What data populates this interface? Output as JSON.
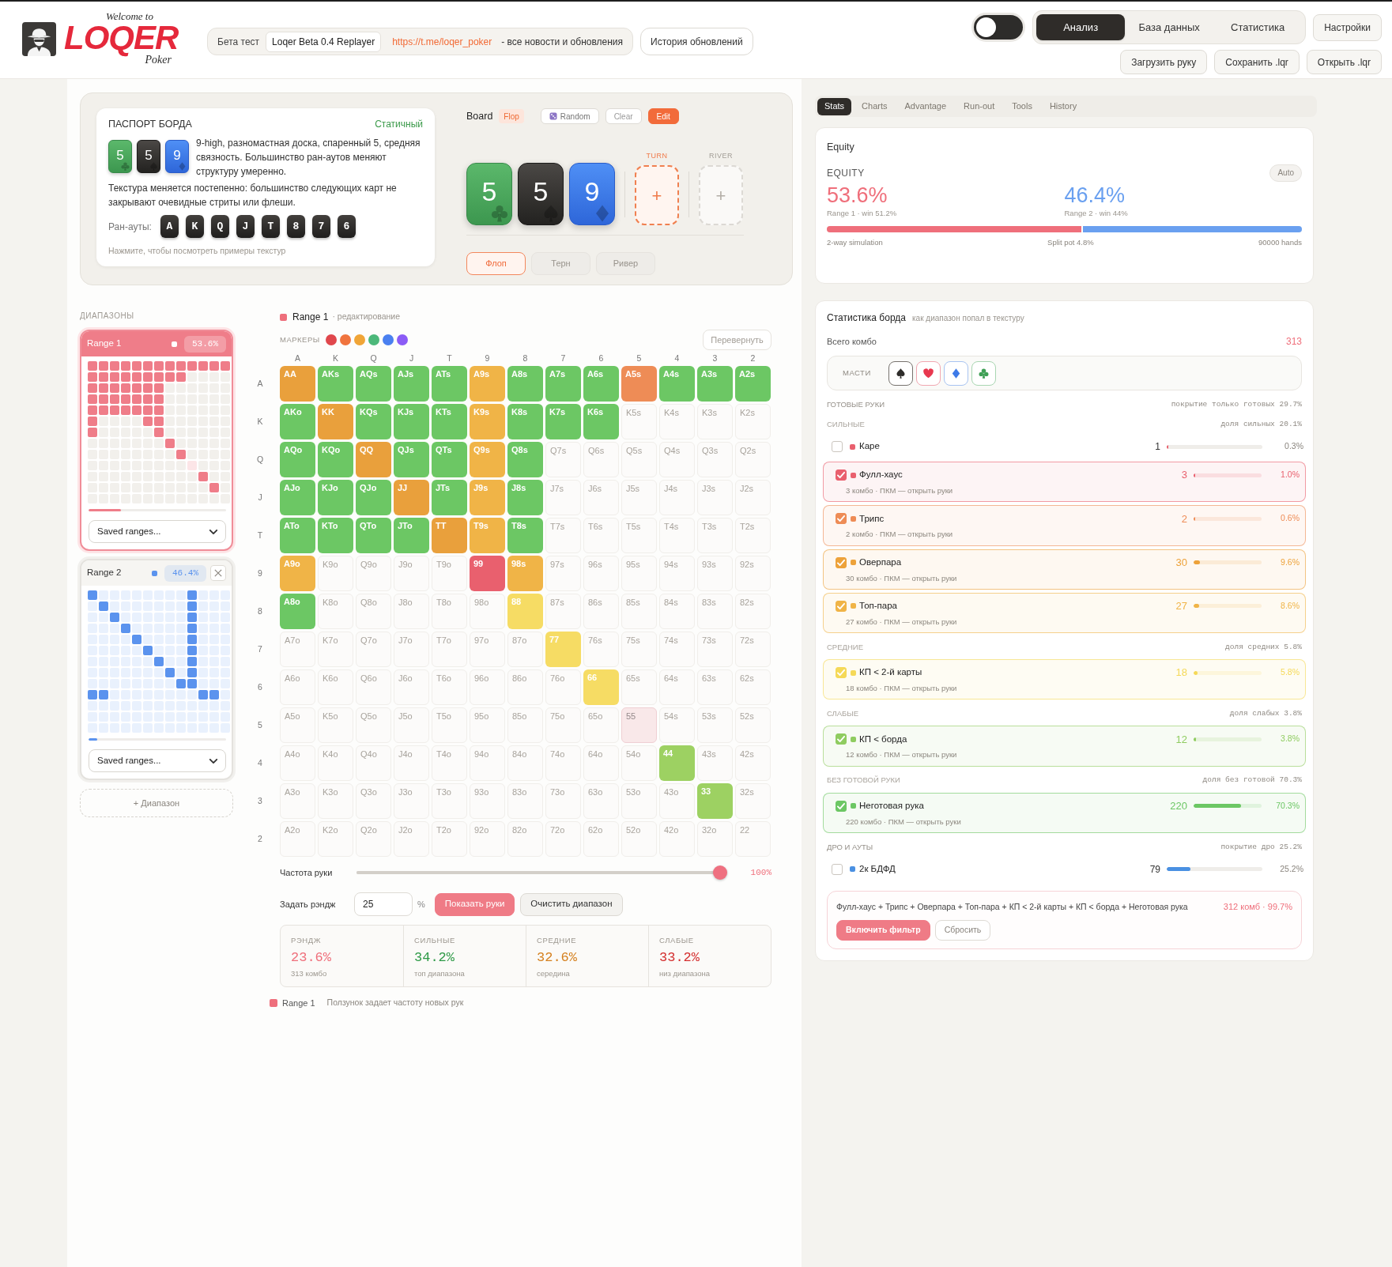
{
  "header": {
    "logo": {
      "top": "Welcome to",
      "main": "LOQER",
      "bottom": "Poker"
    },
    "beta": {
      "label": "Бета тест",
      "version": "Loqer Beta 0.4 Replayer",
      "link": "https://t.me/loqer_poker",
      "note": "- все новости и обновления"
    },
    "history_button": "История обновлений",
    "theme_toggle": {
      "on": false
    },
    "tabs": [
      {
        "label": "Анализ",
        "selected": true
      },
      {
        "label": "База данных",
        "selected": false
      },
      {
        "label": "Статистика",
        "selected": false
      }
    ],
    "settings_button": "Настройки",
    "actions": [
      "Загрузить руку",
      "Сохранить .lqr",
      "Открыть .lqr"
    ]
  },
  "passport": {
    "title": "ПАСПОРТ БОРДА",
    "texture": "Статичный",
    "cards": [
      {
        "rank": "5",
        "kind": "clubs"
      },
      {
        "rank": "5",
        "kind": "spades"
      },
      {
        "rank": "9",
        "kind": "diamonds"
      }
    ],
    "summary": "9-high, разномастная доска, спаренный 5, средняя связность. Большинство ран-аутов меняют структуру умеренно.",
    "dynamics": "Текстура меняется постепенно: большинство следующих карт не закрывают очевидные стриты или флеши.",
    "runouts_label": "Ран-ауты:",
    "runouts": [
      "A",
      "K",
      "Q",
      "J",
      "T",
      "8",
      "7",
      "6"
    ],
    "hint": "Нажмите, чтобы посмотреть примеры текстур"
  },
  "board": {
    "title": "Board",
    "street_tag": "Flop",
    "buttons": [
      {
        "label": "Random",
        "kind": "random"
      },
      {
        "label": "Clear",
        "kind": "plain"
      },
      {
        "label": "Edit",
        "kind": "primary"
      }
    ],
    "cards": [
      {
        "rank": "5",
        "kind": "clubs"
      },
      {
        "rank": "5",
        "kind": "spades"
      },
      {
        "rank": "9",
        "kind": "diamonds"
      }
    ],
    "slots": [
      {
        "label": "TURN",
        "symbol": "+",
        "active": true
      },
      {
        "label": "RIVER",
        "symbol": "+",
        "active": false
      }
    ],
    "streets": [
      {
        "label": "Флоп",
        "selected": true
      },
      {
        "label": "Терн",
        "selected": false
      },
      {
        "label": "Ривер",
        "selected": false
      }
    ]
  },
  "ranges": {
    "title": "ДИАПАЗОНЫ",
    "items": [
      {
        "name": "Range 1",
        "equity": "53.6%",
        "selected": true,
        "closable": false,
        "color": "#ef7d89",
        "level": 0.236,
        "select": "Saved ranges..."
      },
      {
        "name": "Range 2",
        "equity": "46.4%",
        "selected": false,
        "closable": true,
        "color": "#5b93ee",
        "level": 0.065,
        "select": "Saved ranges...",
        "grid": [
          [
            true,
            false,
            false,
            false,
            false,
            false,
            false,
            false,
            false,
            true,
            false,
            false,
            false
          ],
          [
            false,
            true,
            false,
            false,
            false,
            false,
            false,
            false,
            false,
            true,
            false,
            false,
            false
          ],
          [
            false,
            false,
            true,
            false,
            false,
            false,
            false,
            false,
            false,
            true,
            false,
            false,
            false
          ],
          [
            false,
            false,
            false,
            true,
            false,
            false,
            false,
            false,
            false,
            true,
            false,
            false,
            false
          ],
          [
            false,
            false,
            false,
            false,
            true,
            false,
            false,
            false,
            false,
            true,
            false,
            false,
            false
          ],
          [
            false,
            false,
            false,
            false,
            false,
            true,
            false,
            false,
            false,
            true,
            false,
            false,
            false
          ],
          [
            false,
            false,
            false,
            false,
            false,
            false,
            true,
            false,
            false,
            true,
            false,
            false,
            false
          ],
          [
            false,
            false,
            false,
            false,
            false,
            false,
            false,
            true,
            false,
            true,
            false,
            false,
            false
          ],
          [
            false,
            false,
            false,
            false,
            false,
            false,
            false,
            false,
            true,
            true,
            false,
            false,
            false
          ],
          [
            true,
            true,
            false,
            false,
            false,
            false,
            false,
            false,
            false,
            false,
            true,
            true,
            false
          ],
          [
            false,
            false,
            false,
            false,
            false,
            false,
            false,
            false,
            false,
            false,
            false,
            false,
            false
          ],
          [
            false,
            false,
            false,
            false,
            false,
            false,
            false,
            false,
            false,
            false,
            false,
            false,
            false
          ],
          [
            false,
            false,
            false,
            false,
            false,
            false,
            false,
            false,
            false,
            false,
            false,
            false,
            false
          ]
        ]
      }
    ],
    "add_button": "+ Диапазон"
  },
  "matrix": {
    "range": "Range 1",
    "mode": "· редактирование",
    "color": "#ee6f7c",
    "markers_label": "МАРКЕРЫ",
    "markers": [
      {
        "color": "#e0474c"
      },
      {
        "color": "#f0743e"
      },
      {
        "color": "#f0a537"
      },
      {
        "color": "#4cb87a"
      },
      {
        "color": "#4a80f0"
      },
      {
        "color": "#8b5cf6"
      }
    ],
    "flip_button": "Перевернуть",
    "columns": [
      "A",
      "K",
      "Q",
      "J",
      "T",
      "9",
      "8",
      "7",
      "6",
      "5",
      "4",
      "3",
      "2"
    ],
    "rows": [
      {
        "label": "A",
        "cells": [
          {
            "label": "AA",
            "kind": "filled",
            "color": "#e9a03c"
          },
          {
            "label": "AKs",
            "kind": "filled",
            "color": "#6cc764"
          },
          {
            "label": "AQs",
            "kind": "filled",
            "color": "#6cc764"
          },
          {
            "label": "AJs",
            "kind": "filled",
            "color": "#6cc764"
          },
          {
            "label": "ATs",
            "kind": "filled",
            "color": "#6cc764"
          },
          {
            "label": "A9s",
            "kind": "filled",
            "color": "#f0b447"
          },
          {
            "label": "A8s",
            "kind": "filled",
            "color": "#6cc764"
          },
          {
            "label": "A7s",
            "kind": "filled",
            "color": "#6cc764"
          },
          {
            "label": "A6s",
            "kind": "filled",
            "color": "#6cc764"
          },
          {
            "label": "A5s",
            "kind": "filled",
            "color": "#ee8c56"
          },
          {
            "label": "A4s",
            "kind": "filled",
            "color": "#6cc764"
          },
          {
            "label": "A3s",
            "kind": "filled",
            "color": "#6cc764"
          },
          {
            "label": "A2s",
            "kind": "filled",
            "color": "#6cc764"
          }
        ]
      },
      {
        "label": "K",
        "cells": [
          {
            "label": "AKo",
            "kind": "filled",
            "color": "#6cc764"
          },
          {
            "label": "KK",
            "kind": "filled",
            "color": "#e9a03c"
          },
          {
            "label": "KQs",
            "kind": "filled",
            "color": "#6cc764"
          },
          {
            "label": "KJs",
            "kind": "filled",
            "color": "#6cc764"
          },
          {
            "label": "KTs",
            "kind": "filled",
            "color": "#6cc764"
          },
          {
            "label": "K9s",
            "kind": "filled",
            "color": "#f0b447"
          },
          {
            "label": "K8s",
            "kind": "filled",
            "color": "#6cc764"
          },
          {
            "label": "K7s",
            "kind": "filled",
            "color": "#6cc764"
          },
          {
            "label": "K6s",
            "kind": "filled",
            "color": "#6cc764"
          },
          {
            "label": "K5s",
            "kind": "empty"
          },
          {
            "label": "K4s",
            "kind": "empty"
          },
          {
            "label": "K3s",
            "kind": "empty"
          },
          {
            "label": "K2s",
            "kind": "empty"
          }
        ]
      },
      {
        "label": "Q",
        "cells": [
          {
            "label": "AQo",
            "kind": "filled",
            "color": "#6cc764"
          },
          {
            "label": "KQo",
            "kind": "filled",
            "color": "#6cc764"
          },
          {
            "label": "QQ",
            "kind": "filled",
            "color": "#e9a03c"
          },
          {
            "label": "QJs",
            "kind": "filled",
            "color": "#6cc764"
          },
          {
            "label": "QTs",
            "kind": "filled",
            "color": "#6cc764"
          },
          {
            "label": "Q9s",
            "kind": "filled",
            "color": "#f0b447"
          },
          {
            "label": "Q8s",
            "kind": "filled",
            "color": "#6cc764"
          },
          {
            "label": "Q7s",
            "kind": "empty"
          },
          {
            "label": "Q6s",
            "kind": "empty"
          },
          {
            "label": "Q5s",
            "kind": "empty"
          },
          {
            "label": "Q4s",
            "kind": "empty"
          },
          {
            "label": "Q3s",
            "kind": "empty"
          },
          {
            "label": "Q2s",
            "kind": "empty"
          }
        ]
      },
      {
        "label": "J",
        "cells": [
          {
            "label": "AJo",
            "kind": "filled",
            "color": "#6cc764"
          },
          {
            "label": "KJo",
            "kind": "filled",
            "color": "#6cc764"
          },
          {
            "label": "QJo",
            "kind": "filled",
            "color": "#6cc764"
          },
          {
            "label": "JJ",
            "kind": "filled",
            "color": "#e9a03c"
          },
          {
            "label": "JTs",
            "kind": "filled",
            "color": "#6cc764"
          },
          {
            "label": "J9s",
            "kind": "filled",
            "color": "#f0b447"
          },
          {
            "label": "J8s",
            "kind": "filled",
            "color": "#6cc764"
          },
          {
            "label": "J7s",
            "kind": "empty"
          },
          {
            "label": "J6s",
            "kind": "empty"
          },
          {
            "label": "J5s",
            "kind": "empty"
          },
          {
            "label": "J4s",
            "kind": "empty"
          },
          {
            "label": "J3s",
            "kind": "empty"
          },
          {
            "label": "J2s",
            "kind": "empty"
          }
        ]
      },
      {
        "label": "T",
        "cells": [
          {
            "label": "ATo",
            "kind": "filled",
            "color": "#6cc764"
          },
          {
            "label": "KTo",
            "kind": "filled",
            "color": "#6cc764"
          },
          {
            "label": "QTo",
            "kind": "filled",
            "color": "#6cc764"
          },
          {
            "label": "JTo",
            "kind": "filled",
            "color": "#6cc764"
          },
          {
            "label": "TT",
            "kind": "filled",
            "color": "#e9a03c"
          },
          {
            "label": "T9s",
            "kind": "filled",
            "color": "#f0b447"
          },
          {
            "label": "T8s",
            "kind": "filled",
            "color": "#6cc764"
          },
          {
            "label": "T7s",
            "kind": "empty"
          },
          {
            "label": "T6s",
            "kind": "empty"
          },
          {
            "label": "T5s",
            "kind": "empty"
          },
          {
            "label": "T4s",
            "kind": "empty"
          },
          {
            "label": "T3s",
            "kind": "empty"
          },
          {
            "label": "T2s",
            "kind": "empty"
          }
        ]
      },
      {
        "label": "9",
        "cells": [
          {
            "label": "A9o",
            "kind": "filled",
            "color": "#f0b447"
          },
          {
            "label": "K9o",
            "kind": "empty"
          },
          {
            "label": "Q9o",
            "kind": "empty"
          },
          {
            "label": "J9o",
            "kind": "empty"
          },
          {
            "label": "T9o",
            "kind": "empty"
          },
          {
            "label": "99",
            "kind": "filled",
            "color": "#e9606e"
          },
          {
            "label": "98s",
            "kind": "filled",
            "color": "#f0b447"
          },
          {
            "label": "97s",
            "kind": "empty"
          },
          {
            "label": "96s",
            "kind": "empty"
          },
          {
            "label": "95s",
            "kind": "empty"
          },
          {
            "label": "94s",
            "kind": "empty"
          },
          {
            "label": "93s",
            "kind": "empty"
          },
          {
            "label": "92s",
            "kind": "empty"
          }
        ]
      },
      {
        "label": "8",
        "cells": [
          {
            "label": "A8o",
            "kind": "filled",
            "color": "#6cc764"
          },
          {
            "label": "K8o",
            "kind": "empty"
          },
          {
            "label": "Q8o",
            "kind": "empty"
          },
          {
            "label": "J8o",
            "kind": "empty"
          },
          {
            "label": "T8o",
            "kind": "empty"
          },
          {
            "label": "98o",
            "kind": "empty"
          },
          {
            "label": "88",
            "kind": "filled",
            "color": "#f6dc64"
          },
          {
            "label": "87s",
            "kind": "empty"
          },
          {
            "label": "86s",
            "kind": "empty"
          },
          {
            "label": "85s",
            "kind": "empty"
          },
          {
            "label": "84s",
            "kind": "empty"
          },
          {
            "label": "83s",
            "kind": "empty"
          },
          {
            "label": "82s",
            "kind": "empty"
          }
        ]
      },
      {
        "label": "7",
        "cells": [
          {
            "label": "A7o",
            "kind": "empty"
          },
          {
            "label": "K7o",
            "kind": "empty"
          },
          {
            "label": "Q7o",
            "kind": "empty"
          },
          {
            "label": "J7o",
            "kind": "empty"
          },
          {
            "label": "T7o",
            "kind": "empty"
          },
          {
            "label": "97o",
            "kind": "empty"
          },
          {
            "label": "87o",
            "kind": "empty"
          },
          {
            "label": "77",
            "kind": "filled",
            "color": "#f6dc64"
          },
          {
            "label": "76s",
            "kind": "empty"
          },
          {
            "label": "75s",
            "kind": "empty"
          },
          {
            "label": "74s",
            "kind": "empty"
          },
          {
            "label": "73s",
            "kind": "empty"
          },
          {
            "label": "72s",
            "kind": "empty"
          }
        ]
      },
      {
        "label": "6",
        "cells": [
          {
            "label": "A6o",
            "kind": "empty"
          },
          {
            "label": "K6o",
            "kind": "empty"
          },
          {
            "label": "Q6o",
            "kind": "empty"
          },
          {
            "label": "J6o",
            "kind": "empty"
          },
          {
            "label": "T6o",
            "kind": "empty"
          },
          {
            "label": "96o",
            "kind": "empty"
          },
          {
            "label": "86o",
            "kind": "empty"
          },
          {
            "label": "76o",
            "kind": "empty"
          },
          {
            "label": "66",
            "kind": "filled",
            "color": "#f6dc64"
          },
          {
            "label": "65s",
            "kind": "empty"
          },
          {
            "label": "64s",
            "kind": "empty"
          },
          {
            "label": "63s",
            "kind": "empty"
          },
          {
            "label": "62s",
            "kind": "empty"
          }
        ]
      },
      {
        "label": "5",
        "cells": [
          {
            "label": "A5o",
            "kind": "empty"
          },
          {
            "label": "K5o",
            "kind": "empty"
          },
          {
            "label": "Q5o",
            "kind": "empty"
          },
          {
            "label": "J5o",
            "kind": "empty"
          },
          {
            "label": "T5o",
            "kind": "empty"
          },
          {
            "label": "95o",
            "kind": "empty"
          },
          {
            "label": "85o",
            "kind": "empty"
          },
          {
            "label": "75o",
            "kind": "empty"
          },
          {
            "label": "65o",
            "kind": "empty"
          },
          {
            "label": "55",
            "kind": "faded",
            "color": "#f9e8e9"
          },
          {
            "label": "54s",
            "kind": "empty"
          },
          {
            "label": "53s",
            "kind": "empty"
          },
          {
            "label": "52s",
            "kind": "empty"
          }
        ]
      },
      {
        "label": "4",
        "cells": [
          {
            "label": "A4o",
            "kind": "empty"
          },
          {
            "label": "K4o",
            "kind": "empty"
          },
          {
            "label": "Q4o",
            "kind": "empty"
          },
          {
            "label": "J4o",
            "kind": "empty"
          },
          {
            "label": "T4o",
            "kind": "empty"
          },
          {
            "label": "94o",
            "kind": "empty"
          },
          {
            "label": "84o",
            "kind": "empty"
          },
          {
            "label": "74o",
            "kind": "empty"
          },
          {
            "label": "64o",
            "kind": "empty"
          },
          {
            "label": "54o",
            "kind": "empty"
          },
          {
            "label": "44",
            "kind": "filled",
            "color": "#9dd162"
          },
          {
            "label": "43s",
            "kind": "empty"
          },
          {
            "label": "42s",
            "kind": "empty"
          }
        ]
      },
      {
        "label": "3",
        "cells": [
          {
            "label": "A3o",
            "kind": "empty"
          },
          {
            "label": "K3o",
            "kind": "empty"
          },
          {
            "label": "Q3o",
            "kind": "empty"
          },
          {
            "label": "J3o",
            "kind": "empty"
          },
          {
            "label": "T3o",
            "kind": "empty"
          },
          {
            "label": "93o",
            "kind": "empty"
          },
          {
            "label": "83o",
            "kind": "empty"
          },
          {
            "label": "73o",
            "kind": "empty"
          },
          {
            "label": "63o",
            "kind": "empty"
          },
          {
            "label": "53o",
            "kind": "empty"
          },
          {
            "label": "43o",
            "kind": "empty"
          },
          {
            "label": "33",
            "kind": "filled",
            "color": "#9dd162"
          },
          {
            "label": "32s",
            "kind": "empty"
          }
        ]
      },
      {
        "label": "2",
        "cells": [
          {
            "label": "A2o",
            "kind": "empty"
          },
          {
            "label": "K2o",
            "kind": "empty"
          },
          {
            "label": "Q2o",
            "kind": "empty"
          },
          {
            "label": "J2o",
            "kind": "empty"
          },
          {
            "label": "T2o",
            "kind": "empty"
          },
          {
            "label": "92o",
            "kind": "empty"
          },
          {
            "label": "82o",
            "kind": "empty"
          },
          {
            "label": "72o",
            "kind": "empty"
          },
          {
            "label": "62o",
            "kind": "empty"
          },
          {
            "label": "52o",
            "kind": "empty"
          },
          {
            "label": "42o",
            "kind": "empty"
          },
          {
            "label": "32o",
            "kind": "empty"
          },
          {
            "label": "22",
            "kind": "empty"
          }
        ]
      }
    ]
  },
  "frequency": {
    "label": "Частота руки",
    "level": 1,
    "reading": "100%"
  },
  "set_range": {
    "label": "Задать рэндж",
    "value": "25",
    "unit": "%",
    "buttons": [
      {
        "label": "Показать руки",
        "kind": "primary"
      },
      {
        "label": "Очистить диапазон",
        "kind": "secondary"
      }
    ]
  },
  "summary": [
    {
      "label": "РЭНДЖ",
      "value": "23.6%",
      "note": "313 комбо",
      "color": "#ef6f7b"
    },
    {
      "label": "СИЛЬНЫЕ",
      "value": "34.2%",
      "note": "топ диапазона",
      "color": "#2e9a47"
    },
    {
      "label": "СРЕДНИЕ",
      "value": "32.6%",
      "note": "середина",
      "color": "#d5801f"
    },
    {
      "label": "СЛАБЫЕ",
      "value": "33.2%",
      "note": "низ диапазона",
      "color": "#d42e2e"
    }
  ],
  "legend": {
    "range": "Range 1",
    "color": "#ee6f7c",
    "note": "Ползунок задает частоту новых рук"
  },
  "panel_tabs": [
    {
      "label": "Stats",
      "selected": true
    },
    {
      "label": "Charts",
      "selected": false
    },
    {
      "label": "Advantage",
      "selected": false
    },
    {
      "label": "Run-out",
      "selected": false
    },
    {
      "label": "Tools",
      "selected": false
    },
    {
      "label": "History",
      "selected": false
    }
  ],
  "equity": {
    "title": "Equity",
    "label": "EQUITY",
    "mode_button": "Auto",
    "players": [
      {
        "value": "53.6%",
        "caption": "Range 1 · win 51.2%",
        "color": "#ef6f7b",
        "level": 0.536
      },
      {
        "value": "46.4%",
        "caption": "Range 2 · win 44%",
        "color": "#6aa0f0",
        "level": 0.464
      }
    ],
    "footer": [
      "2-way simulation",
      "Split pot 4.8%",
      "90000 hands"
    ]
  },
  "board_stats": {
    "title": "Статистика борда",
    "subtitle": "как диапазон попал в текстуру",
    "total_label": "Всего комбо",
    "total": "313",
    "suits_label": "МАСТИ",
    "suits": [
      {
        "kind": "spades"
      },
      {
        "kind": "hearts"
      },
      {
        "kind": "diamonds"
      },
      {
        "kind": "clubs"
      }
    ],
    "sections": [
      {
        "title": "ГОТОВЫЕ РУКИ",
        "note": "покрытие только готовых 29.7%",
        "kind": "group"
      },
      {
        "title": "СИЛЬНЫЕ",
        "note": "доля сильных 20.1%",
        "kind": "subgroup",
        "rows": [
          {
            "name": "Каре",
            "checked": false,
            "color": "#e9606e",
            "count": "1",
            "level": 0.003,
            "percent": "0.3%"
          },
          {
            "name": "Фулл-хаус",
            "checked": true,
            "color": "#e9606e",
            "count": "3",
            "level": 0.01,
            "percent": "1.0%",
            "detail": "3 комбо · ПКМ — открыть руки"
          },
          {
            "name": "Трипс",
            "checked": true,
            "color": "#ee8c56",
            "count": "2",
            "level": 0.006,
            "percent": "0.6%",
            "detail": "2 комбо · ПКМ — открыть руки"
          },
          {
            "name": "Оверпара",
            "checked": true,
            "color": "#eda23a",
            "count": "30",
            "level": 0.096,
            "percent": "9.6%",
            "detail": "30 комбо · ПКМ — открыть руки"
          },
          {
            "name": "Топ-пара",
            "checked": true,
            "color": "#f0b447",
            "count": "27",
            "level": 0.086,
            "percent": "8.6%",
            "detail": "27 комбо · ПКМ — открыть руки"
          }
        ]
      },
      {
        "title": "СРЕДНИЕ",
        "note": "доля средних 5.8%",
        "kind": "subgroup",
        "rows": [
          {
            "name": "КП < 2-й карты",
            "checked": true,
            "color": "#f5d958",
            "count": "18",
            "level": 0.058,
            "percent": "5.8%",
            "detail": "18 комбо · ПКМ — открыть руки"
          }
        ]
      },
      {
        "title": "СЛАБЫЕ",
        "note": "доля слабых 3.8%",
        "kind": "subgroup",
        "rows": [
          {
            "name": "КП < борда",
            "checked": true,
            "color": "#8fcc60",
            "count": "12",
            "level": 0.038,
            "percent": "3.8%",
            "detail": "12 комбо · ПКМ — открыть руки"
          }
        ]
      },
      {
        "title": "БЕЗ ГОТОВОЙ РУКИ",
        "note": "доля без готовой 70.3%",
        "kind": "subgroup",
        "rows": [
          {
            "name": "Неготовая рука",
            "checked": true,
            "color": "#6cc764",
            "count": "220",
            "level": 0.703,
            "percent": "70.3%",
            "detail": "220 комбо · ПКМ — открыть руки"
          }
        ]
      },
      {
        "title": "ДРО И АУТЫ",
        "note": "покрытие дро 25.2%",
        "kind": "group",
        "rows": [
          {
            "name": "2к БДФД",
            "checked": false,
            "color": "#4a90e2",
            "count": "79",
            "level": 0.252,
            "percent": "25.2%"
          }
        ]
      }
    ],
    "filter": {
      "text": "Фулл-хаус + Трипс + Оверпара + Топ-пара + КП < 2-й карты + КП < борда + Неготовая рука",
      "result": "312 комб · 99.7%",
      "buttons": [
        {
          "label": "Включить фильтр",
          "kind": "primary"
        },
        {
          "label": "Сбросить",
          "kind": "secondary"
        }
      ]
    }
  }
}
